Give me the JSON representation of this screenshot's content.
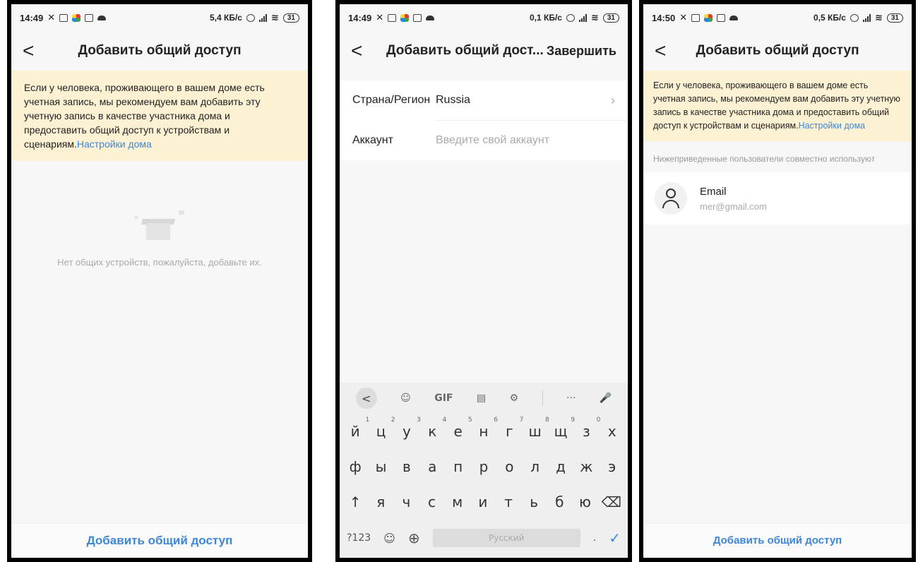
{
  "screen1": {
    "status": {
      "time": "14:49",
      "speed": "5,4 КБ/с",
      "battery": "31"
    },
    "header": {
      "back": "<",
      "title": "Добавить общий доступ"
    },
    "notice": {
      "text": "Если у человека, проживающего в вашем доме есть учетная запись, мы рекомендуем вам добавить эту учетную запись в качестве участника дома и предоставить общий доступ к устройствам и сценариям.",
      "link": "Настройки дома"
    },
    "empty_text": "Нет общих устройств, пожалуйста, добавьте их.",
    "bottom_button": "Добавить общий доступ"
  },
  "screen2": {
    "status": {
      "time": "14:49",
      "speed": "0,1 КБ/с",
      "battery": "31"
    },
    "header": {
      "back": "<",
      "title": "Добавить общий дост...",
      "done": "Завершить"
    },
    "form": {
      "region_label": "Страна/Регион",
      "region_value": "Russia",
      "account_label": "Аккаунт",
      "account_placeholder": "Введите свой аккаунт"
    },
    "keyboard": {
      "toolbar": [
        "<",
        "☺",
        "GIF",
        "▤",
        "⚙",
        "···",
        "🎤"
      ],
      "row1": [
        "й",
        "ц",
        "у",
        "к",
        "е",
        "н",
        "г",
        "ш",
        "щ",
        "з",
        "х"
      ],
      "row1_nums": [
        "1",
        "2",
        "3",
        "4",
        "5",
        "6",
        "7",
        "8",
        "9",
        "0",
        ""
      ],
      "row2": [
        "ф",
        "ы",
        "в",
        "а",
        "п",
        "р",
        "о",
        "л",
        "д",
        "ж",
        "э"
      ],
      "row3": [
        "↑",
        "я",
        "ч",
        "с",
        "м",
        "и",
        "т",
        "ь",
        "б",
        "ю",
        "⌫"
      ],
      "sym_key": "?123",
      "emoji_key": "☺",
      "globe_key": "⊕",
      "space_label": "Русский",
      "period": ".",
      "enter": "✓"
    }
  },
  "screen3": {
    "status": {
      "time": "14:50",
      "speed": "0,5 КБ/с",
      "battery": "31"
    },
    "header": {
      "back": "<",
      "title": "Добавить общий доступ"
    },
    "notice": {
      "text": "Если у человека, проживающего в вашем доме есть учетная запись, мы рекомендуем вам добавить эту учетную запись в качестве участника дома и предоставить общий доступ к устройствам и сценариям.",
      "link": "Настройки дома"
    },
    "section_label": "Нижеприведенные пользователи совместно используют",
    "user": {
      "name": "Email",
      "email": "mer@gmail.com"
    },
    "bottom_button": "Добавить общий доступ"
  },
  "colors": {
    "accent": "#3d86d8",
    "notice_bg": "#fdf1d3",
    "screen_bg": "#f7f7f7"
  }
}
